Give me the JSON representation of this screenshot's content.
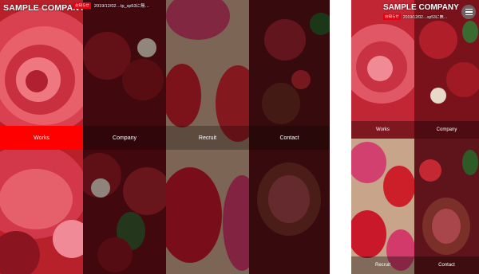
{
  "site": {
    "logo": "SAMPLE COMPANY",
    "news_badge": "お知らせ",
    "news_text": "2019/12/02…tp_sp53に無…"
  },
  "nav": [
    "Works",
    "Company",
    "Recruit",
    "Contact"
  ],
  "mobile": {
    "logo": "SAMPLE COMPANY",
    "news_text": "2019/12/02…sp53に無…",
    "tiles": [
      "Works",
      "Company",
      "Recruit",
      "Contact"
    ],
    "menu_icon": "hamburger-menu-icon"
  },
  "colors": {
    "accent": "#ff0000",
    "badge": "#e60012"
  }
}
